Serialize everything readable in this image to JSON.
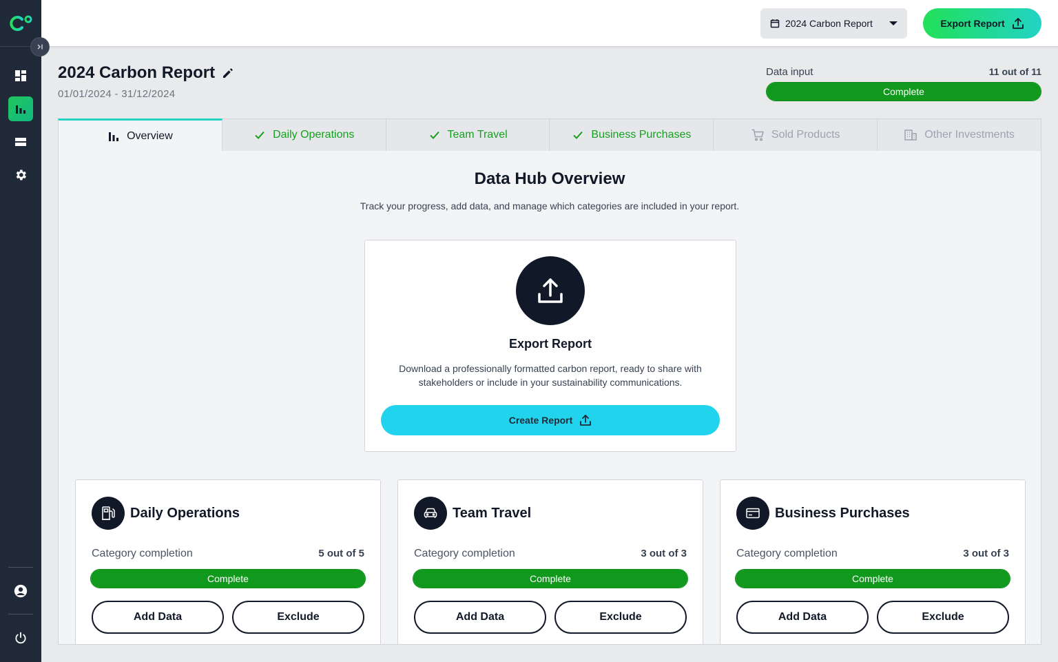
{
  "colors": {
    "sidebar_bg": "#1f2937",
    "accent_green": "#22c55e",
    "complete_green": "#11991d",
    "cyan_button": "#22d3ee",
    "dark": "#111827"
  },
  "sidebar": {
    "logo_icon": "c-degree-logo",
    "items": [
      {
        "icon": "dashboard-icon",
        "active": false
      },
      {
        "icon": "bar-chart-icon",
        "active": true
      },
      {
        "icon": "database-icon",
        "active": false
      },
      {
        "icon": "gear-icon",
        "active": false
      }
    ],
    "bottom": [
      {
        "icon": "user-account-icon"
      },
      {
        "icon": "power-icon"
      }
    ]
  },
  "topbar": {
    "report_select": "2024 Carbon Report",
    "export_label": "Export Report"
  },
  "header": {
    "title": "2024 Carbon Report",
    "dates": "01/01/2024 - 31/12/2024",
    "data_input": {
      "label": "Data input",
      "count": "11 out of 11",
      "progress": 1.0,
      "status": "Complete"
    }
  },
  "tabs": [
    {
      "label": "Overview",
      "icon": "bar-chart-icon",
      "state": "active"
    },
    {
      "label": "Daily Operations",
      "icon": "check-icon",
      "state": "done"
    },
    {
      "label": "Team Travel",
      "icon": "check-icon",
      "state": "done"
    },
    {
      "label": "Business Purchases",
      "icon": "check-icon",
      "state": "done"
    },
    {
      "label": "Sold Products",
      "icon": "cart-icon",
      "state": "disabled"
    },
    {
      "label": "Other Investments",
      "icon": "building-icon",
      "state": "disabled"
    }
  ],
  "overview": {
    "title": "Data Hub Overview",
    "subtitle": "Track your progress, add data, and manage which categories are included in your report."
  },
  "export_card": {
    "title": "Export Report",
    "description": "Download a professionally formatted carbon report, ready to share with stakeholders or include in your sustainability communications.",
    "button": "Create Report"
  },
  "categories": [
    {
      "name": "Daily Operations",
      "icon": "fuel-station-icon",
      "completion_label": "Category completion",
      "count": "5 out of 5",
      "progress": 1.0,
      "status": "Complete",
      "add": "Add Data",
      "exclude": "Exclude"
    },
    {
      "name": "Team Travel",
      "icon": "car-icon",
      "completion_label": "Category completion",
      "count": "3 out of 3",
      "progress": 1.0,
      "status": "Complete",
      "add": "Add Data",
      "exclude": "Exclude"
    },
    {
      "name": "Business Purchases",
      "icon": "credit-card-icon",
      "completion_label": "Category completion",
      "count": "3 out of 3",
      "progress": 1.0,
      "status": "Complete",
      "add": "Add Data",
      "exclude": "Exclude"
    }
  ]
}
